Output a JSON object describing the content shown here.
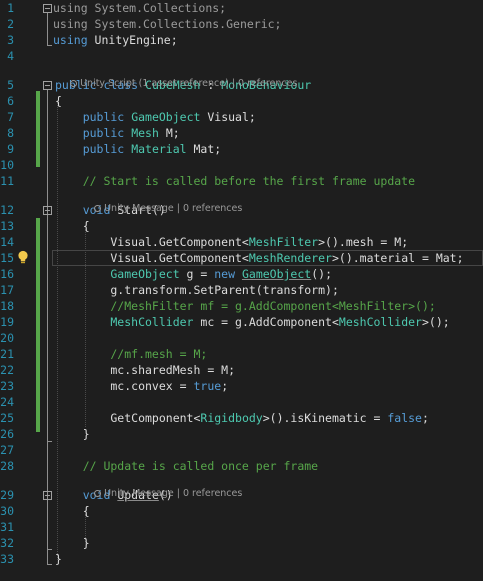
{
  "editor": {
    "lines": [
      {
        "num": "1",
        "tokens": [
          {
            "t": "using",
            "c": "using"
          },
          {
            "t": " System.Collections;",
            "c": "using"
          }
        ]
      },
      {
        "num": "2",
        "tokens": [
          {
            "t": "using",
            "c": "using"
          },
          {
            "t": " System.Collections.Generic;",
            "c": "using"
          }
        ]
      },
      {
        "num": "3",
        "tokens": [
          {
            "t": "using",
            "c": "kw"
          },
          {
            "t": " UnityEngine;",
            "c": "plain"
          }
        ]
      },
      {
        "num": "4",
        "tokens": []
      },
      {
        "num": "5",
        "tokens": [
          {
            "t": "public",
            "c": "kw"
          },
          {
            "t": " ",
            "c": "plain"
          },
          {
            "t": "class",
            "c": "kw"
          },
          {
            "t": " ",
            "c": "plain"
          },
          {
            "t": "CubeMesh",
            "c": "type"
          },
          {
            "t": " : ",
            "c": "plain"
          },
          {
            "t": "MonoBehaviour",
            "c": "type"
          }
        ]
      },
      {
        "num": "6",
        "tokens": [
          {
            "t": "{",
            "c": "plain"
          }
        ]
      },
      {
        "num": "7",
        "tokens": [
          {
            "t": "    public",
            "c": "kw"
          },
          {
            "t": " ",
            "c": "plain"
          },
          {
            "t": "GameObject",
            "c": "type"
          },
          {
            "t": " Visual;",
            "c": "plain"
          }
        ]
      },
      {
        "num": "8",
        "tokens": [
          {
            "t": "    public",
            "c": "kw"
          },
          {
            "t": " ",
            "c": "plain"
          },
          {
            "t": "Mesh",
            "c": "type"
          },
          {
            "t": " M;",
            "c": "plain"
          }
        ]
      },
      {
        "num": "9",
        "tokens": [
          {
            "t": "    public",
            "c": "kw"
          },
          {
            "t": " ",
            "c": "plain"
          },
          {
            "t": "Material",
            "c": "type"
          },
          {
            "t": " Mat;",
            "c": "plain"
          }
        ]
      },
      {
        "num": "10",
        "tokens": []
      },
      {
        "num": "11",
        "tokens": [
          {
            "t": "    // Start is called before the first frame update",
            "c": "comment"
          }
        ]
      },
      {
        "num": "12",
        "tokens": [
          {
            "t": "    void",
            "c": "kw"
          },
          {
            "t": " Start()",
            "c": "plain"
          }
        ]
      },
      {
        "num": "13",
        "tokens": [
          {
            "t": "    {",
            "c": "plain"
          }
        ]
      },
      {
        "num": "14",
        "tokens": [
          {
            "t": "        Visual.GetComponent<",
            "c": "plain"
          },
          {
            "t": "MeshFilter",
            "c": "type"
          },
          {
            "t": ">().mesh = M;",
            "c": "plain"
          }
        ]
      },
      {
        "num": "15",
        "tokens": [
          {
            "t": "        Visual.GetComponent<",
            "c": "plain"
          },
          {
            "t": "MeshRenderer",
            "c": "type"
          },
          {
            "t": ">().material = Mat;",
            "c": "plain"
          }
        ]
      },
      {
        "num": "16",
        "tokens": [
          {
            "t": "        GameObject",
            "c": "type"
          },
          {
            "t": " g = ",
            "c": "plain"
          },
          {
            "t": "new",
            "c": "kw"
          },
          {
            "t": " ",
            "c": "plain"
          },
          {
            "t": "GameObject",
            "c": "type",
            "u": true
          },
          {
            "t": "();",
            "c": "plain"
          }
        ]
      },
      {
        "num": "17",
        "tokens": [
          {
            "t": "        g.transform.SetParent(transform);",
            "c": "plain"
          }
        ]
      },
      {
        "num": "18",
        "tokens": [
          {
            "t": "        //MeshFilter mf = g.AddComponent<MeshFilter>();",
            "c": "comment"
          }
        ]
      },
      {
        "num": "19",
        "tokens": [
          {
            "t": "        MeshCollider",
            "c": "type"
          },
          {
            "t": " mc = g.AddComponent<",
            "c": "plain"
          },
          {
            "t": "MeshCollider",
            "c": "type"
          },
          {
            "t": ">();",
            "c": "plain"
          }
        ]
      },
      {
        "num": "20",
        "tokens": []
      },
      {
        "num": "21",
        "tokens": [
          {
            "t": "        //mf.mesh = M;",
            "c": "comment"
          }
        ]
      },
      {
        "num": "22",
        "tokens": [
          {
            "t": "        mc.sharedMesh = M;",
            "c": "plain"
          }
        ]
      },
      {
        "num": "23",
        "tokens": [
          {
            "t": "        mc.convex = ",
            "c": "plain"
          },
          {
            "t": "true",
            "c": "kw"
          },
          {
            "t": ";",
            "c": "plain"
          }
        ]
      },
      {
        "num": "24",
        "tokens": []
      },
      {
        "num": "25",
        "tokens": [
          {
            "t": "        GetComponent<",
            "c": "plain"
          },
          {
            "t": "Rigidbody",
            "c": "type"
          },
          {
            "t": ">().isKinematic = ",
            "c": "plain"
          },
          {
            "t": "false",
            "c": "kw"
          },
          {
            "t": ";",
            "c": "plain"
          }
        ]
      },
      {
        "num": "26",
        "tokens": [
          {
            "t": "    }",
            "c": "plain"
          }
        ]
      },
      {
        "num": "27",
        "tokens": []
      },
      {
        "num": "28",
        "tokens": [
          {
            "t": "    // Update is called once per frame",
            "c": "comment"
          }
        ]
      },
      {
        "num": "29",
        "tokens": [
          {
            "t": "    void",
            "c": "kw"
          },
          {
            "t": " ",
            "c": "plain"
          },
          {
            "t": "Update",
            "c": "plain",
            "u": true
          },
          {
            "t": "()",
            "c": "plain"
          }
        ]
      },
      {
        "num": "30",
        "tokens": [
          {
            "t": "    {",
            "c": "plain"
          }
        ]
      },
      {
        "num": "31",
        "tokens": []
      },
      {
        "num": "32",
        "tokens": [
          {
            "t": "    }",
            "c": "plain"
          }
        ]
      },
      {
        "num": "33",
        "tokens": [
          {
            "t": "}",
            "c": "plain"
          }
        ]
      }
    ],
    "codelens": [
      {
        "text": "Unity Script (1 asset reference) | 0 references",
        "icon": "unity-icon"
      },
      {
        "text": "Unity Message | 0 references",
        "icon": "unity-icon"
      },
      {
        "text": "Unity Message | 0 references",
        "icon": "unity-icon"
      }
    ],
    "lightbulb_icon": "lightbulb-icon",
    "colors": {
      "background": "#1e1e1e",
      "line_number": "#2b91af",
      "keyword": "#569cd6",
      "type": "#4ec9b0",
      "comment": "#57a64a",
      "plain": "#dcdcdc",
      "codelens": "#999999",
      "change_bar": "#57a64a"
    }
  }
}
